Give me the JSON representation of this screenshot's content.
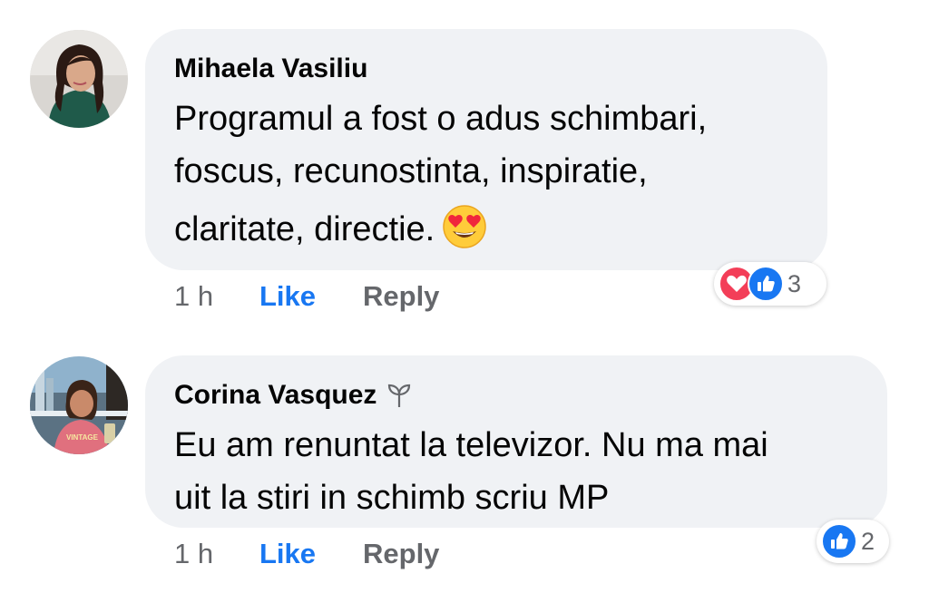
{
  "comments": [
    {
      "author": "Mihaela Vasiliu",
      "text_lines": [
        "Programul a fost o adus schimbari,",
        "foscus, recunostinta, inspiratie,",
        "claritate, directie."
      ],
      "emoji": "heart-eyes-emoji",
      "time": "1 h",
      "like_label": "Like",
      "reply_label": "Reply",
      "reactions": [
        "love",
        "like"
      ],
      "reaction_count": "3"
    },
    {
      "author": "Corina Vasquez",
      "author_badge": "new-member-sprout-icon",
      "text_lines": [
        "Eu am renuntat la televizor. Nu ma mai",
        "uit la stiri in schimb scriu MP"
      ],
      "time": "1 h",
      "like_label": "Like",
      "reply_label": "Reply",
      "reactions": [
        "like"
      ],
      "reaction_count": "2"
    }
  ],
  "colors": {
    "bubble": "#f0f2f5",
    "like_blue": "#1877f2",
    "love_red": "#f33e58",
    "meta_gray": "#65676b"
  }
}
